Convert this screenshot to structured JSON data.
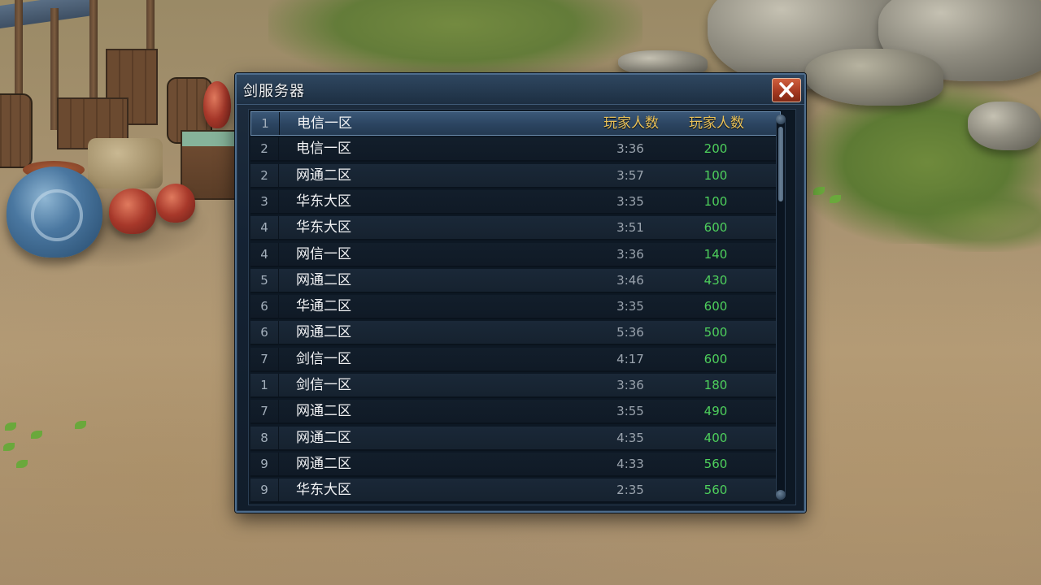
{
  "panel": {
    "title": "剑服务器",
    "close_icon": "close-x-icon",
    "accent_colors": {
      "header_text": "#e9c25a",
      "count_text": "#4ed05c",
      "close_button": "#b8452a"
    }
  },
  "columns": {
    "time_header": "玩家人数",
    "count_header": "玩家人数"
  },
  "servers": [
    {
      "num": "1",
      "name": "电信一区",
      "time": "",
      "count": "",
      "is_header": true
    },
    {
      "num": "2",
      "name": "电信一区",
      "time": "3:36",
      "count": "200"
    },
    {
      "num": "2",
      "name": "网通二区",
      "time": "3:57",
      "count": "100"
    },
    {
      "num": "3",
      "name": "华东大区",
      "time": "3:35",
      "count": "100"
    },
    {
      "num": "4",
      "name": "华东大区",
      "time": "3:51",
      "count": "600"
    },
    {
      "num": "4",
      "name": "网信一区",
      "time": "3:36",
      "count": "140"
    },
    {
      "num": "5",
      "name": "网通二区",
      "time": "3:46",
      "count": "430"
    },
    {
      "num": "6",
      "name": "华通二区",
      "time": "3:35",
      "count": "600"
    },
    {
      "num": "6",
      "name": "网通二区",
      "time": "5:36",
      "count": "500"
    },
    {
      "num": "7",
      "name": "剑信一区",
      "time": "4:17",
      "count": "600"
    },
    {
      "num": "1",
      "name": "剑信一区",
      "time": "3:36",
      "count": "180"
    },
    {
      "num": "7",
      "name": "网通二区",
      "time": "3:55",
      "count": "490"
    },
    {
      "num": "8",
      "name": "网通二区",
      "time": "4:35",
      "count": "400"
    },
    {
      "num": "9",
      "name": "网通二区",
      "time": "4:33",
      "count": "560"
    },
    {
      "num": "9",
      "name": "华东大区",
      "time": "2:35",
      "count": "560"
    }
  ],
  "scroll": {
    "position": 0.0
  }
}
